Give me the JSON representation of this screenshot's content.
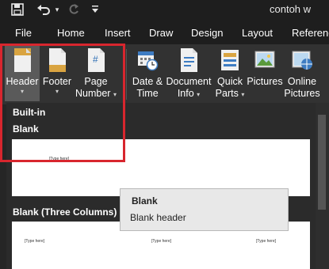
{
  "app": {
    "doc_title": "contoh w"
  },
  "menu": {
    "tabs": [
      "File",
      "Home",
      "Insert",
      "Draw",
      "Design",
      "Layout",
      "Referenc"
    ]
  },
  "ribbon": {
    "header": {
      "label": "Header",
      "caret": "▾"
    },
    "footer": {
      "label": "Footer",
      "caret": "▾"
    },
    "page_number": {
      "line1": "Page",
      "line2": "Number",
      "caret": "▾"
    },
    "date_time": {
      "line1": "Date &",
      "line2": "Time"
    },
    "document_info": {
      "line1": "Document",
      "line2": "Info",
      "caret": "▾"
    },
    "quick_parts": {
      "line1": "Quick",
      "line2": "Parts",
      "caret": "▾"
    },
    "pictures": {
      "label": "Pictures"
    },
    "online_pictures": {
      "line1": "Online",
      "line2": "Pictures"
    }
  },
  "gallery": {
    "section_builtin": "Built-in",
    "item_blank": "Blank",
    "item_blank_three": "Blank (Three Columns)",
    "placeholder": "[Type here]"
  },
  "tooltip": {
    "title": "Blank",
    "description": "Blank header"
  },
  "colors": {
    "highlight": "#d8262e",
    "ribbon_bg": "#323232",
    "titlebar_bg": "#1e1e1e"
  }
}
